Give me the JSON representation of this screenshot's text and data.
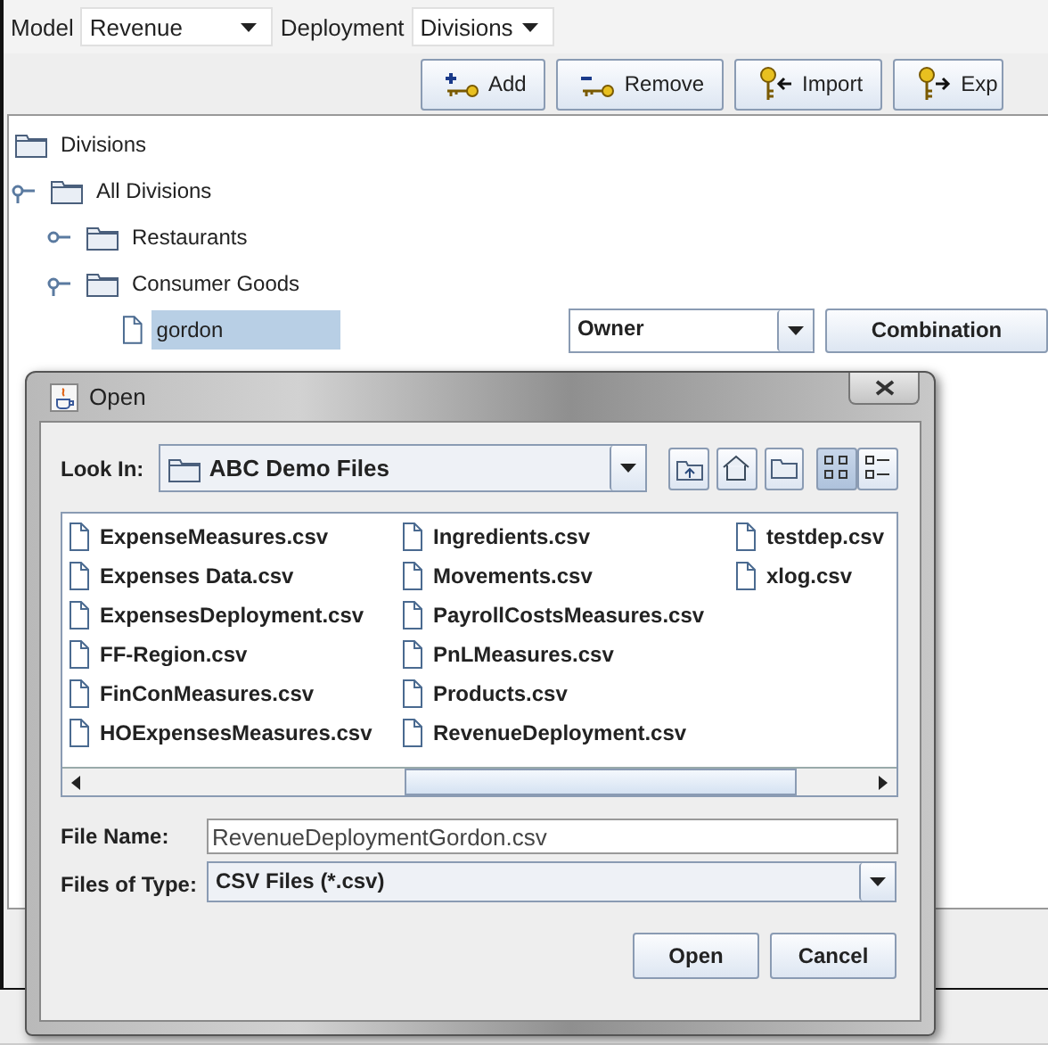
{
  "main": {
    "model": {
      "label": "Model",
      "value": "Revenue"
    },
    "deployment": {
      "label": "Deployment",
      "value": "Divisions"
    },
    "toolbar": [
      {
        "kind": "add",
        "label": "Add"
      },
      {
        "kind": "remove",
        "label": "Remove"
      },
      {
        "kind": "import",
        "label": "Import"
      },
      {
        "kind": "export",
        "label": "Exp"
      }
    ],
    "tree": {
      "label": "Divisions",
      "selected": false,
      "children": [
        {
          "label": "All Divisions",
          "expanded": true,
          "selected": false,
          "children": [
            {
              "label": "Restaurants",
              "expanded": false,
              "selected": false
            },
            {
              "label": "Consumer Goods",
              "expanded": true,
              "selected": false,
              "children": [
                {
                  "kind": "file",
                  "label": "gordon",
                  "selected": true
                }
              ]
            }
          ]
        }
      ]
    },
    "owner_combo": {
      "value": "Owner"
    },
    "combination_button": "Combination"
  },
  "dialog": {
    "title": "Open",
    "look_in": {
      "label": "Look In:",
      "value": "ABC Demo Files"
    },
    "nav_buttons": [
      {
        "kind": "up"
      },
      {
        "kind": "home"
      },
      {
        "kind": "new_folder"
      }
    ],
    "view_buttons": [
      {
        "kind": "list",
        "selected": true
      },
      {
        "kind": "details",
        "selected": false
      }
    ],
    "files": [
      "ExpenseMeasures.csv",
      "Expenses Data.csv",
      "ExpensesDeployment.csv",
      "FF-Region.csv",
      "FinConMeasures.csv",
      "HOExpensesMeasures.csv",
      "Ingredients.csv",
      "Movements.csv",
      "PayrollCostsMeasures.csv",
      "PnLMeasures.csv",
      "Products.csv",
      "RevenueDeployment.csv",
      "testdep.csv",
      "xlog.csv"
    ],
    "file_name": {
      "label": "File Name:",
      "value": "RevenueDeploymentGordon.csv"
    },
    "file_type": {
      "label": "Files of Type:",
      "value": "CSV Files (*.csv)"
    },
    "buttons": [
      "Open",
      "Cancel"
    ]
  }
}
